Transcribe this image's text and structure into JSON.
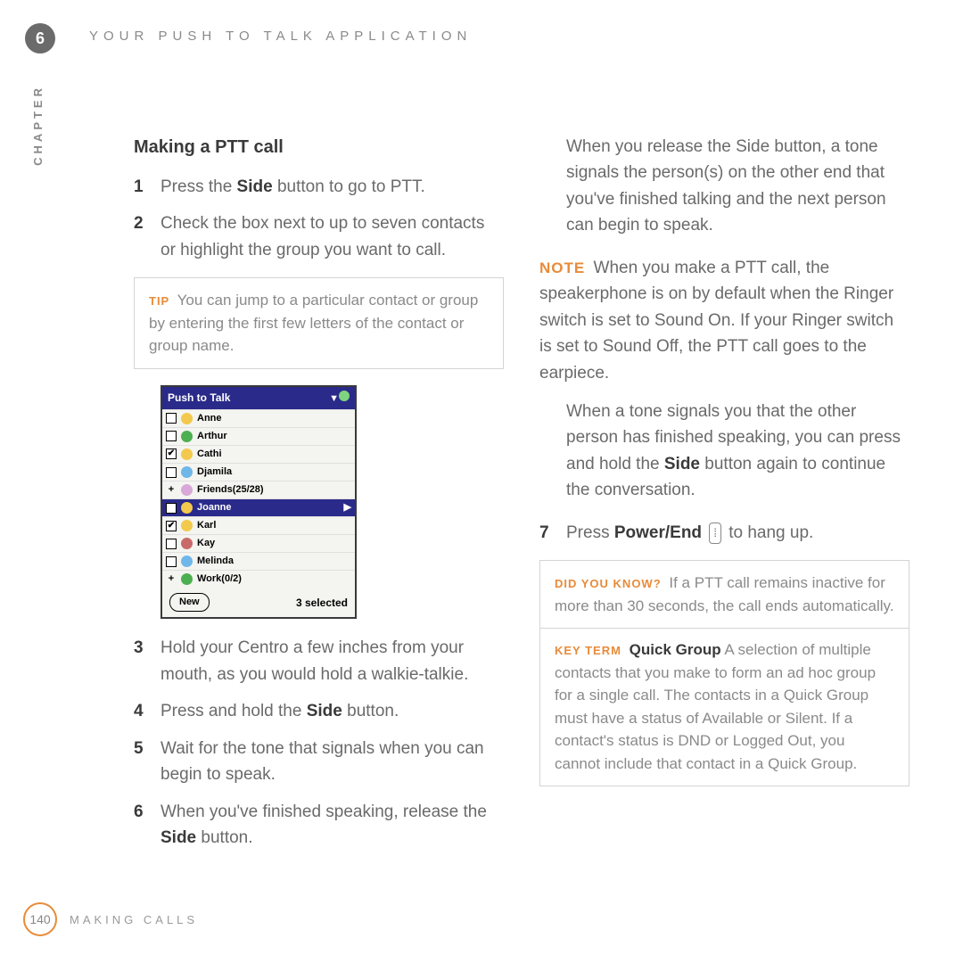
{
  "chapter_number": "6",
  "header_title": "YOUR PUSH TO TALK APPLICATION",
  "side_label": "CHAPTER",
  "page_number": "140",
  "footer_text": "MAKING CALLS",
  "left": {
    "heading": "Making a PTT call",
    "step1a": "Press the ",
    "step1_bold": "Side",
    "step1b": " button to go to PTT.",
    "step2": "Check the box next to up to seven contacts or highlight the group you want to call.",
    "tip_label": "TIP",
    "tip_text": " You can jump to a particular contact or group by entering the first few letters of the contact or group name.",
    "step3": "Hold your Centro a few inches from your mouth, as you would hold a walkie-talkie.",
    "step4a": "Press and hold the ",
    "step4_bold": "Side",
    "step4b": " button.",
    "step5": "Wait for the tone that signals when you can begin to speak.",
    "step6a": "When you've finished speaking, release the ",
    "step6_bold": "Side",
    "step6b": " button."
  },
  "right": {
    "para1": "When you release the Side button, a tone signals the person(s) on the other end that you've finished talking and the next person can begin to speak.",
    "note_label": "NOTE",
    "note_text": " When you make a PTT call, the speakerphone is on by default when the Ringer switch is set to Sound On. If your Ringer switch is set to Sound Off, the PTT call goes to the earpiece.",
    "para2a": "When a tone signals you that the other person has finished speaking, you can press and hold the ",
    "para2_bold": "Side",
    "para2b": " button again to continue the conversation.",
    "step7a": "Press ",
    "step7_bold": "Power/End",
    "step7b": " to hang up.",
    "dyk_label": "DID YOU KNOW?",
    "dyk_text": " If a PTT call remains inactive for more than 30 seconds, the call ends automatically.",
    "kt_label": "KEY TERM",
    "kt_bold": " Quick Group",
    "kt_text": "   A selection of multiple contacts that you make to form an ad hoc group for a single call. The contacts in a Quick Group must have a status of Available or Silent. If a contact's status is DND or Logged Out, you cannot include that contact in a Quick Group."
  },
  "phone": {
    "title": "Push to Talk",
    "rows": [
      {
        "check": false,
        "plus": false,
        "icon": "#f2c94c",
        "name": "Anne",
        "sel": false
      },
      {
        "check": false,
        "plus": false,
        "icon": "#4caf50",
        "name": "Arthur",
        "sel": false
      },
      {
        "check": true,
        "plus": false,
        "icon": "#f2c94c",
        "name": "Cathi",
        "sel": false
      },
      {
        "check": false,
        "plus": false,
        "icon": "#6fb7e8",
        "name": "Djamila",
        "sel": false
      },
      {
        "check": false,
        "plus": true,
        "icon": "#d8a8d8",
        "name": "Friends(25/28)",
        "sel": false
      },
      {
        "check": true,
        "plus": false,
        "icon": "#f2c94c",
        "name": "Joanne",
        "sel": true
      },
      {
        "check": true,
        "plus": false,
        "icon": "#f2c94c",
        "name": "Karl",
        "sel": false
      },
      {
        "check": false,
        "plus": false,
        "icon": "#c96a6a",
        "name": "Kay",
        "sel": false
      },
      {
        "check": false,
        "plus": false,
        "icon": "#6fb7e8",
        "name": "Melinda",
        "sel": false
      },
      {
        "check": false,
        "plus": true,
        "icon": "#4caf50",
        "name": "Work(0/2)",
        "sel": false
      }
    ],
    "new_label": "New",
    "selected_text": "3 selected"
  }
}
